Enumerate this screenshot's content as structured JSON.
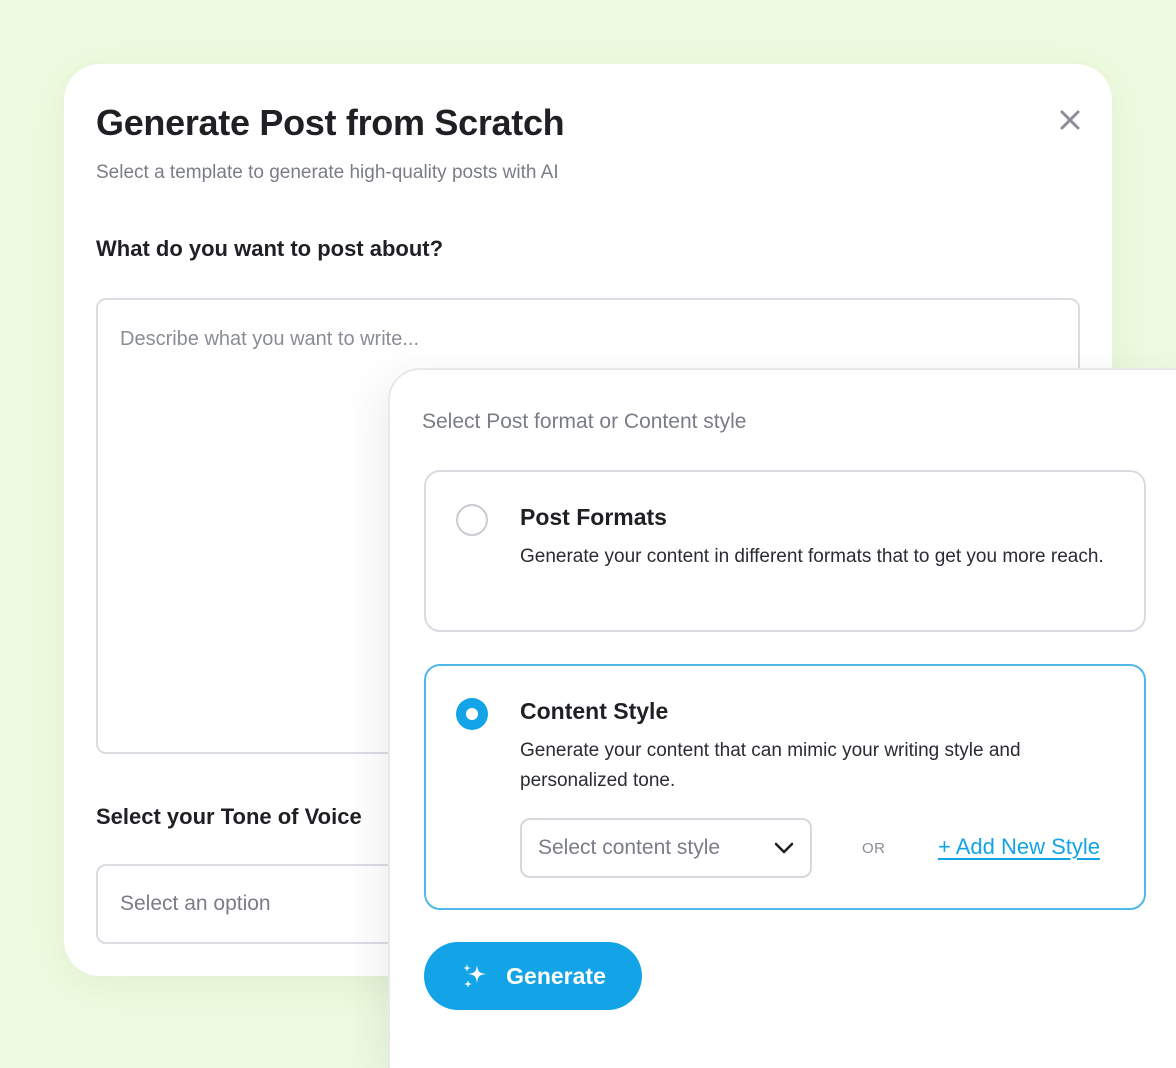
{
  "modal": {
    "title": "Generate Post from Scratch",
    "subtitle": "Select a template to generate high-quality posts with AI",
    "topic_label": "What do you want to post about?",
    "topic_placeholder": "Describe what you want to write...",
    "tone_label": "Select your Tone of Voice",
    "tone_placeholder": "Select an option"
  },
  "panel": {
    "heading": "Select Post format or Content style",
    "options": [
      {
        "title": "Post Formats",
        "description": "Generate your content in different formats that to get you more reach.",
        "selected": false
      },
      {
        "title": "Content Style",
        "description": "Generate your content that can mimic your writing style and personalized tone.",
        "selected": true
      }
    ],
    "style_select_placeholder": "Select content style",
    "or_text": "OR",
    "add_style_label": "+ Add New Style",
    "generate_label": "Generate"
  },
  "colors": {
    "accent": "#12a4e6",
    "background": "#eefbe0",
    "selected_border": "#4fb7ea"
  },
  "icons": {
    "close": "close-icon",
    "chevron": "chevron-down-icon",
    "generate": "sparkle-icon"
  }
}
